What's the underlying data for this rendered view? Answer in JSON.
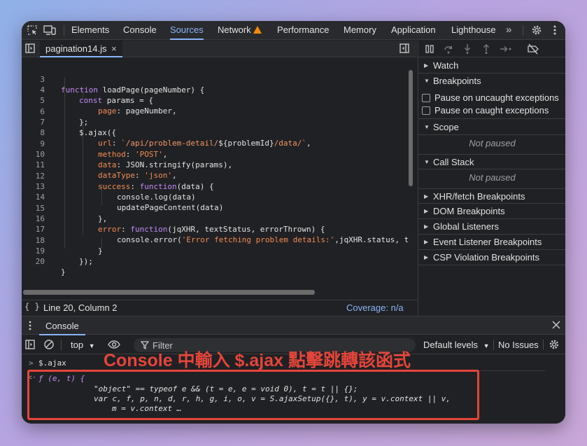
{
  "toolbar": {
    "tabs": [
      "Elements",
      "Console",
      "Sources",
      "Network",
      "Performance",
      "Memory",
      "Application",
      "Lighthouse"
    ],
    "active_tab": "Sources",
    "more_symbol": "»"
  },
  "editor": {
    "file_tab": "pagination14.js",
    "close_symbol": "×",
    "lines": [
      {
        "n": "3"
      },
      {
        "n": "4"
      },
      {
        "n": "5"
      },
      {
        "n": "6"
      },
      {
        "n": "7"
      },
      {
        "n": "8"
      },
      {
        "n": "9"
      },
      {
        "n": "10"
      },
      {
        "n": "11"
      },
      {
        "n": "12"
      },
      {
        "n": "13"
      },
      {
        "n": "14"
      },
      {
        "n": "15"
      },
      {
        "n": "16"
      },
      {
        "n": "17"
      },
      {
        "n": "18"
      },
      {
        "n": "19"
      },
      {
        "n": "20"
      }
    ],
    "code": {
      "l3_kw": "function",
      "l3_rest": " loadPage(pageNumber) {",
      "l4_kw": "const",
      "l4_rest": " params = {",
      "l5_prop": "page",
      "l5_rest": ": pageNumber,",
      "l6": "};",
      "l7": "$.ajax({",
      "l8_prop": "url",
      "l8_colon": ": ",
      "l8_str1": "`/api/problem-detail/",
      "l8_interp": "${problemId}",
      "l8_str2": "/data/`",
      "l8_end": ",",
      "l9_prop": "method",
      "l9_colon": ": ",
      "l9_str": "'POST'",
      "l9_end": ",",
      "l10_prop": "data",
      "l10_rest": ": JSON.stringify(params),",
      "l11_prop": "dataType",
      "l11_colon": ": ",
      "l11_str": "'json'",
      "l11_end": ",",
      "l12_prop": "success",
      "l12_colon": ": ",
      "l12_kw": "function",
      "l12_rest": "(data) {",
      "l13": "console.log(data)",
      "l14": "updatePageContent(data)",
      "l15": "},",
      "l16_prop": "error",
      "l16_colon": ": ",
      "l16_kw": "function",
      "l16_rest": "(jqXHR, textStatus, errorThrown) {",
      "l17_a": "console.error(",
      "l17_str": "'Error fetching problem details:'",
      "l17_b": ",jqXHR.status, t",
      "l18": "}",
      "l19": "});",
      "l20": "}"
    },
    "status_left": "Line 20, Column 2",
    "status_right": "Coverage: n/a",
    "braces_icon": "{ }"
  },
  "sidebar": {
    "watch": "Watch",
    "breakpoints": "Breakpoints",
    "pause_uncaught": "Pause on uncaught exceptions",
    "pause_caught": "Pause on caught exceptions",
    "scope": "Scope",
    "not_paused_1": "Not paused",
    "call_stack": "Call Stack",
    "not_paused_2": "Not paused",
    "xhr": "XHR/fetch Breakpoints",
    "dom": "DOM Breakpoints",
    "global": "Global Listeners",
    "event": "Event Listener Breakpoints",
    "csp": "CSP Violation Breakpoints"
  },
  "console": {
    "drawer_tab": "Console",
    "context": "top",
    "filter_placeholder": "Filter",
    "levels": "Default levels",
    "issues": "No Issues",
    "input_prompt": ">",
    "input": "$.ajax",
    "output_marker": "<·",
    "output_line1": "ƒ (e, t) {",
    "output_line2": "\"object\" == typeof e && (t = e, e = void 0), t = t || {};",
    "output_line3": "var c, f, p, n, d, r, h, g, i, o, v = S.ajaxSetup({}, t), y = v.context || v,",
    "output_line4": "m = v.context …"
  },
  "annotation": {
    "text": "Console 中輸入 $.ajax 點擊跳轉該函式",
    "color": "#e5453a"
  },
  "colors": {
    "accent": "#8ab4f8",
    "background": "#202124",
    "keyword": "#c58af9",
    "string": "#f28b54",
    "warning": "#f28b00"
  }
}
